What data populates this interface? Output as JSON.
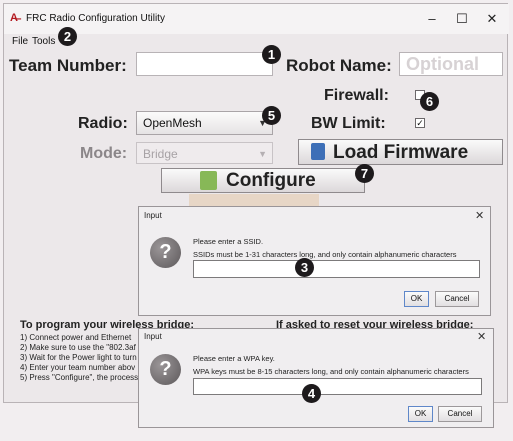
{
  "window": {
    "title": "FRC Radio Configuration Utility",
    "minimize": "–",
    "maximize": "☐",
    "close": "✕"
  },
  "menu": {
    "file": "File",
    "tools": "Tools"
  },
  "form": {
    "team_number_label": "Team Number:",
    "team_number_value": "",
    "robot_name_label": "Robot Name:",
    "robot_name_placeholder": "Optional",
    "firewall_label": "Firewall:",
    "firewall_checked": false,
    "bw_limit_label": "BW Limit:",
    "bw_limit_check": "✓",
    "radio_label": "Radio:",
    "radio_value": "OpenMesh",
    "mode_label": "Mode:",
    "mode_value": "Bridge",
    "load_firmware_label": "Load Firmware",
    "configure_label": "Configure"
  },
  "badges": [
    "1",
    "2",
    "3",
    "4",
    "5",
    "6",
    "7"
  ],
  "instructions": {
    "program_header": "To program your wireless bridge:",
    "reset_header": "If asked to reset your wireless bridge:",
    "steps": [
      "1) Connect power and Ethernet",
      "2) Make sure to use the \"802.3af",
      "3) Wait for the Power light to turn",
      "4) Enter your team number abov",
      "5) Press \"Configure\", the process"
    ]
  },
  "dialog_ssid": {
    "title": "Input",
    "message": "Please enter a SSID.",
    "detail": "SSIDs must be 1-31 characters long, and only contain alphanumeric characters",
    "value": "",
    "ok": "OK",
    "cancel": "Cancel"
  },
  "dialog_wpa": {
    "title": "Input",
    "message": "Please enter a WPA key.",
    "detail": "WPA keys must be 8-15 characters long, and only contain alphanumeric characters",
    "value": "",
    "ok": "OK",
    "cancel": "Cancel"
  },
  "icons": {
    "question": "?",
    "dropdown_arrow": "▼",
    "dialog_close": "✕"
  }
}
